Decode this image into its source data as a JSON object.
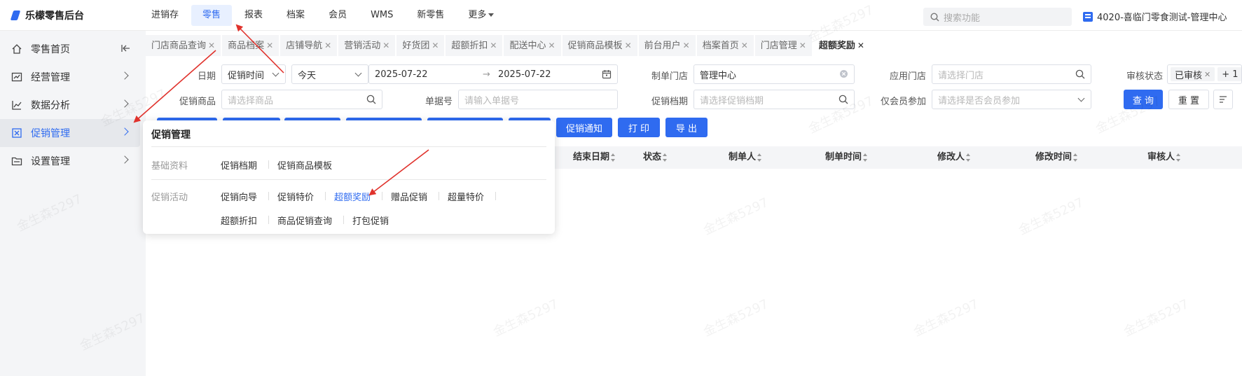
{
  "app": {
    "title": "乐檬零售后台"
  },
  "topnav": {
    "items": [
      "进销存",
      "零售",
      "报表",
      "档案",
      "会员",
      "WMS",
      "新零售",
      "更多"
    ],
    "search_placeholder": "搜索功能",
    "store": "4020-喜临门零食测试-管理中心"
  },
  "sidebar": {
    "items": [
      "零售首页",
      "经营管理",
      "数据分析",
      "促销管理",
      "设置管理"
    ]
  },
  "tabs": [
    "门店商品查询",
    "商品档案",
    "店铺导航",
    "营销活动",
    "好货团",
    "超额折扣",
    "配送中心",
    "促销商品模板",
    "前台用户",
    "档案首页",
    "门店管理",
    "超额奖励"
  ],
  "filters": {
    "date_label": "日期",
    "date_type": "促销时间",
    "date_range": "今天",
    "date_start": "2025-07-22",
    "date_arrow": "→",
    "date_end": "2025-07-22",
    "maker_store_label": "制单门店",
    "maker_store_value": "管理中心",
    "apply_store_label": "应用门店",
    "apply_store_placeholder": "请选择门店",
    "audit_label": "审核状态",
    "audit_tag": "已审核",
    "audit_more": "+ 1 .",
    "promo_goods_label": "促销商品",
    "promo_goods_placeholder": "请选择商品",
    "bill_label": "单据号",
    "bill_placeholder": "请输入单据号",
    "promo_file_label": "促销档期",
    "promo_file_placeholder": "请选择促销档期",
    "member_label": "仅会员参加",
    "member_placeholder": "请选择是否会员参加",
    "query_btn": "查 询",
    "reset_btn": "重 置"
  },
  "actions": {
    "notify": "促销通知",
    "print": "打 印",
    "export": "导 出"
  },
  "table": {
    "columns": [
      "结束日期",
      "状态",
      "制单人",
      "制单时间",
      "修改人",
      "修改时间",
      "审核人"
    ]
  },
  "popover": {
    "title": "促销管理",
    "groups": [
      {
        "label": "基础资料",
        "links": [
          "促销档期",
          "促销商品模板"
        ]
      },
      {
        "label": "促销活动",
        "links": [
          "促销向导",
          "促销特价",
          "超额奖励",
          "赠品促销",
          "超量特价",
          "超额折扣",
          "商品促销查询",
          "打包促销"
        ]
      }
    ]
  },
  "watermark": "金生森5297",
  "colors": {
    "accent": "#2f6bf0",
    "arrow": "#e0322c"
  }
}
